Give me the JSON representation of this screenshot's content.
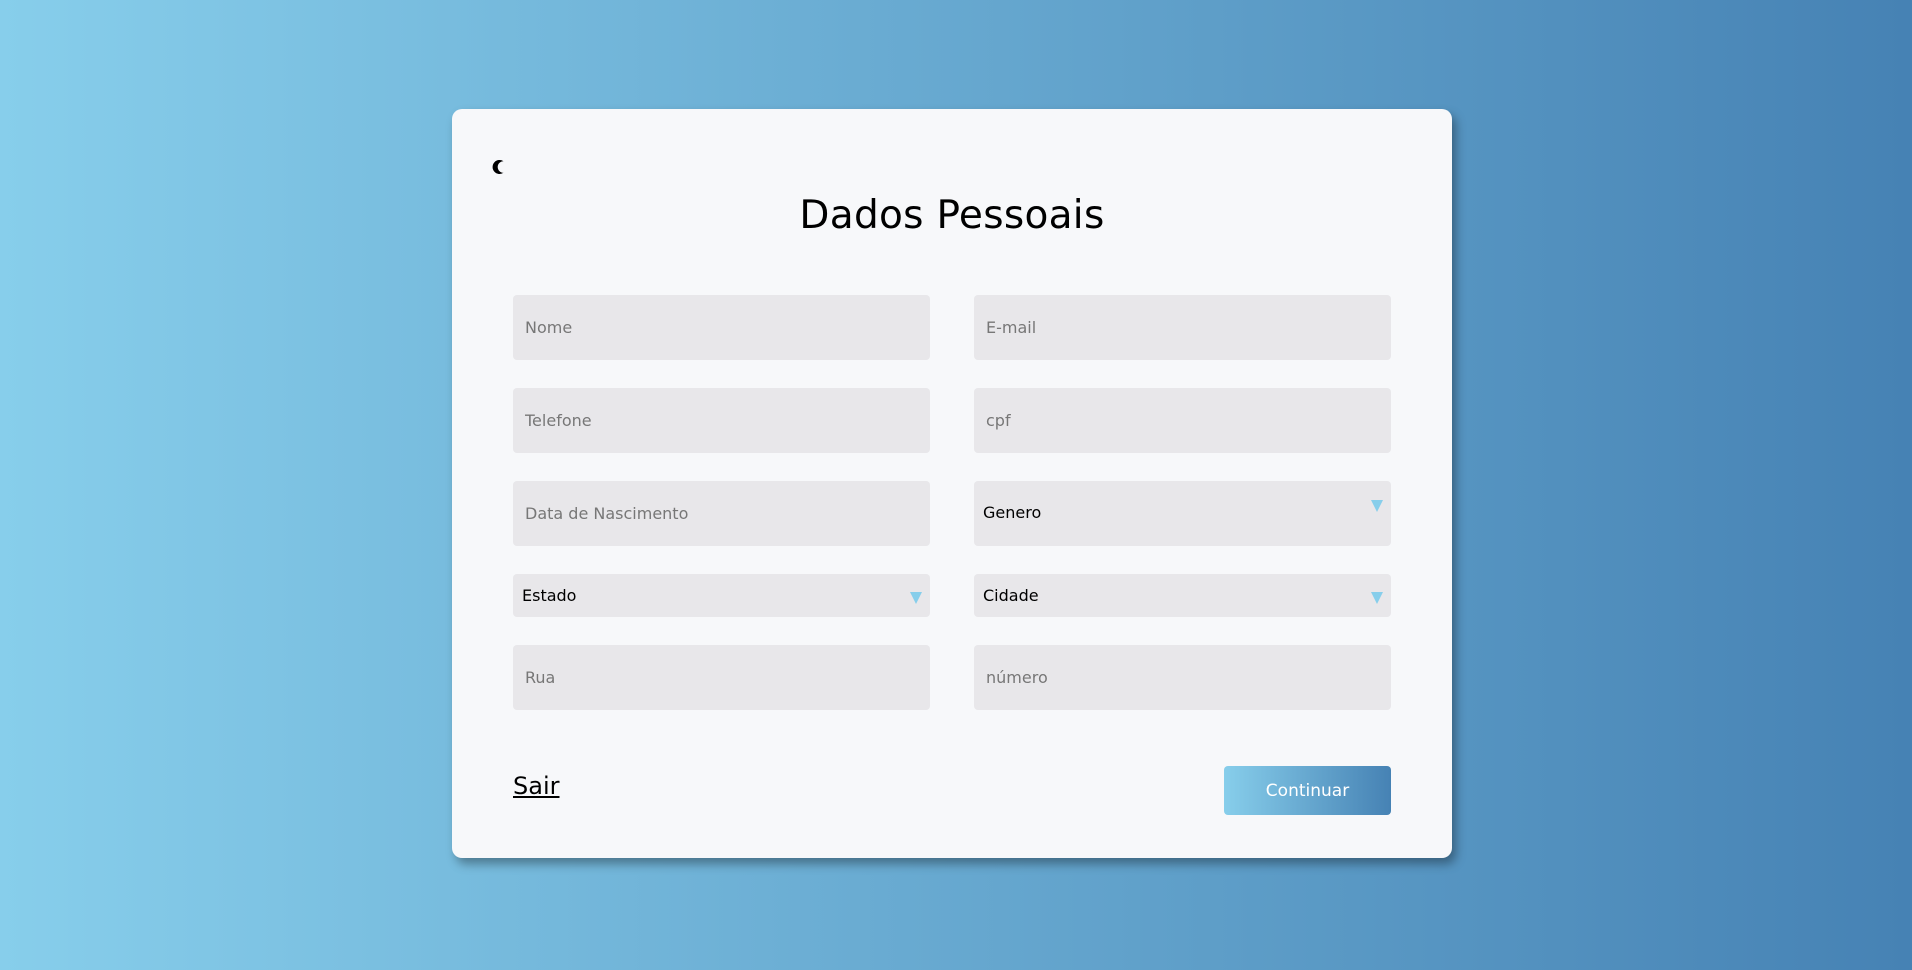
{
  "form": {
    "title": "Dados Pessoais",
    "theme_toggle_icon": "moon-icon",
    "fields": {
      "nome": {
        "placeholder": "Nome",
        "value": ""
      },
      "email": {
        "placeholder": "E-mail",
        "value": ""
      },
      "telefone": {
        "placeholder": "Telefone",
        "value": ""
      },
      "cpf": {
        "placeholder": "cpf",
        "value": ""
      },
      "nascimento": {
        "placeholder": "Data de Nascimento",
        "value": ""
      },
      "rua": {
        "placeholder": "Rua",
        "value": ""
      },
      "numero": {
        "placeholder": "número",
        "value": ""
      }
    },
    "selects": {
      "genero": {
        "selected": "Genero"
      },
      "estado": {
        "selected": "Estado"
      },
      "cidade": {
        "selected": "Cidade"
      }
    },
    "sair_label": "Sair",
    "continuar_label": "Continuar"
  },
  "colors": {
    "gradient_start": "#87ceeb",
    "gradient_end": "#4682b4",
    "card_bg": "#f7f8fa",
    "field_bg": "#e8e7ea",
    "caret": "#87ceeb"
  }
}
